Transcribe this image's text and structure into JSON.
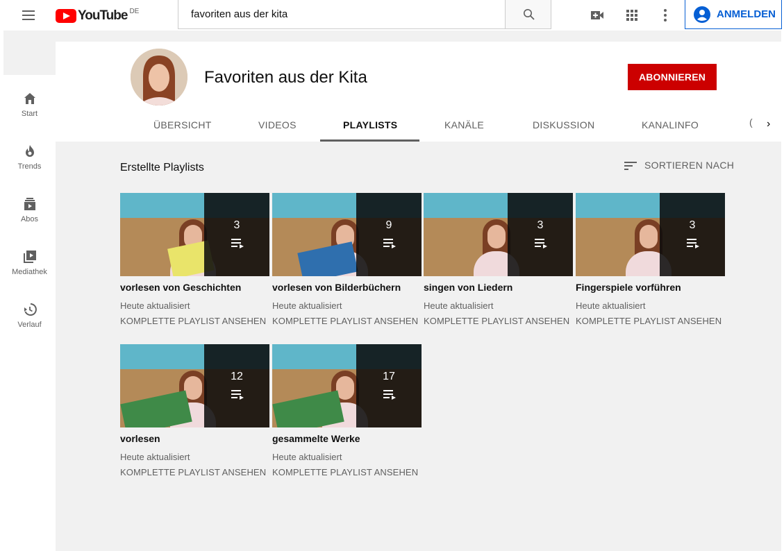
{
  "header": {
    "logo_text": "YouTube",
    "logo_region": "DE",
    "search_value": "favoriten aus der kita",
    "signin_label": "ANMELDEN"
  },
  "sidebar": {
    "items": [
      {
        "label": "Start",
        "icon": "home-icon"
      },
      {
        "label": "Trends",
        "icon": "trending-icon"
      },
      {
        "label": "Abos",
        "icon": "subscriptions-icon"
      },
      {
        "label": "Mediathek",
        "icon": "library-icon"
      },
      {
        "label": "Verlauf",
        "icon": "history-icon"
      }
    ]
  },
  "channel": {
    "name": "Favoriten aus der Kita",
    "subscribe_label": "ABONNIEREN",
    "tabs": [
      {
        "label": "ÜBERSICHT"
      },
      {
        "label": "VIDEOS"
      },
      {
        "label": "PLAYLISTS"
      },
      {
        "label": "KANÄLE"
      },
      {
        "label": "DISKUSSION"
      },
      {
        "label": "KANALINFO"
      }
    ],
    "tab_truncated": "(",
    "next_arrow": "›"
  },
  "section": {
    "title": "Erstellte Playlists",
    "sort_label": "SORTIEREN NACH"
  },
  "playlists": [
    {
      "title": "vorlesen von Geschichten",
      "count": "3",
      "updated": "Heute aktualisiert",
      "link": "KOMPLETTE PLAYLIST ANSEHEN"
    },
    {
      "title": "vorlesen von Bilderbüchern",
      "count": "9",
      "updated": "Heute aktualisiert",
      "link": "KOMPLETTE PLAYLIST ANSEHEN"
    },
    {
      "title": "singen von Liedern",
      "count": "3",
      "updated": "Heute aktualisiert",
      "link": "KOMPLETTE PLAYLIST ANSEHEN"
    },
    {
      "title": "Fingerspiele vorführen",
      "count": "3",
      "updated": "Heute aktualisiert",
      "link": "KOMPLETTE PLAYLIST ANSEHEN"
    },
    {
      "title": "vorlesen",
      "count": "12",
      "updated": "Heute aktualisiert",
      "link": "KOMPLETTE PLAYLIST ANSEHEN"
    },
    {
      "title": "gesammelte Werke",
      "count": "17",
      "updated": "Heute aktualisiert",
      "link": "KOMPLETTE PLAYLIST ANSEHEN"
    }
  ],
  "colors": {
    "brand_red": "#ff0000",
    "subscribe_red": "#cc0000",
    "signin_blue": "#065fd4",
    "background_grey": "#f1f1f1"
  }
}
